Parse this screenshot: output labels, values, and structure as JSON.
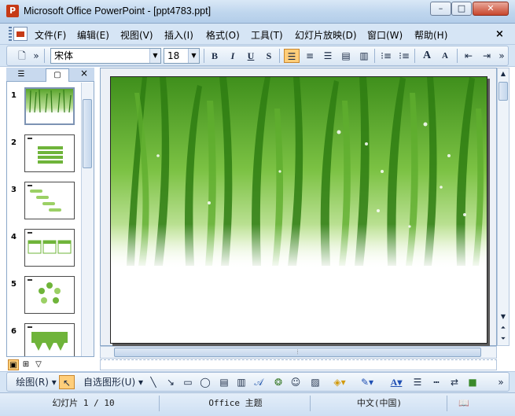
{
  "window": {
    "title": "Microsoft Office PowerPoint - [ppt4783.ppt]",
    "min_label": "–",
    "max_label": "□",
    "close_label": "✕"
  },
  "menu": {
    "items": [
      "文件(F)",
      "编辑(E)",
      "视图(V)",
      "插入(I)",
      "格式(O)",
      "工具(T)",
      "幻灯片放映(D)",
      "窗口(W)",
      "帮助(H)"
    ],
    "close_label": "×"
  },
  "formatting": {
    "font_name": "宋体",
    "font_size": "18",
    "bold": "B",
    "italic": "I",
    "underline": "U",
    "shadow": "S",
    "grow_font": "A",
    "shrink_font": "A"
  },
  "slides_pane": {
    "close_label": "×",
    "slides": [
      {
        "number": "1",
        "selected": true
      },
      {
        "number": "2",
        "selected": false
      },
      {
        "number": "3",
        "selected": false
      },
      {
        "number": "4",
        "selected": false
      },
      {
        "number": "5",
        "selected": false
      },
      {
        "number": "6",
        "selected": false
      }
    ]
  },
  "drawing_toolbar": {
    "draw_label": "绘图(R)",
    "autoshapes_label": "自选图形(U)",
    "font_color_label": "A"
  },
  "status": {
    "slide_info": "幻灯片 1 / 10",
    "design": "Office 主题",
    "language": "中文(中国)"
  },
  "colors": {
    "accent": "#6fb43a",
    "title_bar": "#c8dbf0",
    "status_bar": "#d7e6f6"
  }
}
